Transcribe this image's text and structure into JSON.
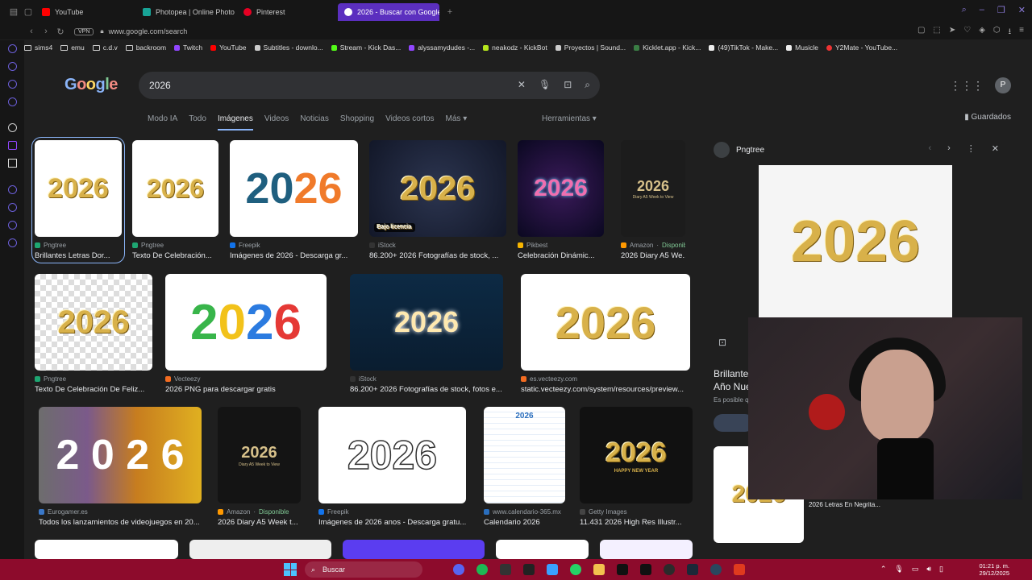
{
  "tabs": [
    {
      "label": "YouTube",
      "color": "#ff0000"
    },
    {
      "label": "Photopea | Online Photo E",
      "color": "#18a497"
    },
    {
      "label": "Pinterest",
      "color": "#e60023"
    },
    {
      "label": "2026 - Buscar con Google",
      "color": "#4285f4",
      "active": true
    }
  ],
  "address": {
    "vpn": "VPN",
    "url": "www.google.com/search"
  },
  "bookmarks": [
    "sims4",
    "emu",
    "c.d.v",
    "backroom",
    "Twitch",
    "YouTube",
    "Subtitles - downlo...",
    "Stream - Kick Das...",
    "alyssamydudes -...",
    "neakodz - KickBot",
    "Proyectos | Sound...",
    "Kicklet.app - Kick...",
    "(49)TikTok - Make...",
    "Musicle",
    "Y2Mate - YouTube..."
  ],
  "google": {
    "logo": "Google",
    "query": "2026",
    "avatar": "P",
    "nav": [
      "Modo IA",
      "Todo",
      "Imágenes",
      "Videos",
      "Noticias",
      "Shopping",
      "Videos cortos",
      "Más"
    ],
    "active_nav": "Imágenes",
    "tools": "Herramientas",
    "saved": "Guardados"
  },
  "results": [
    {
      "source": "Pngtree",
      "caption": "Brillantes Letras Dor...",
      "color": "#1ea672"
    },
    {
      "source": "Pngtree",
      "caption": "Texto De Celebración...",
      "color": "#1ea672"
    },
    {
      "source": "Freepik",
      "caption": "Imágenes de 2026 - Descarga gr...",
      "color": "#1273eb"
    },
    {
      "source": "iStock",
      "caption": "86.200+ 2026 Fotografías de stock, ...",
      "color": "#333333",
      "badge": "Bajo licencia"
    },
    {
      "source": "Pikbest",
      "caption": "Celebración Dinámic...",
      "color": "#f7b500"
    },
    {
      "source": "Amazon",
      "avail": "Disponible",
      "caption": "2026 Diary A5 We...",
      "color": "#ff9900"
    },
    {
      "source": "Pngtree",
      "caption": "Texto De Celebración De Feliz...",
      "color": "#1ea672"
    },
    {
      "source": "Vecteezy",
      "caption": "2026 PNG para descargar gratis",
      "color": "#f36c21"
    },
    {
      "source": "iStock",
      "caption": "86.200+ 2026 Fotografías de stock, fotos e...",
      "color": "#333333"
    },
    {
      "source": "es.vecteezy.com",
      "caption": "static.vecteezy.com/system/resources/preview...",
      "color": "#f36c21"
    },
    {
      "source": "Eurogamer.es",
      "caption": "Todos los lanzamientos de videojuegos en 20...",
      "color": "#3a78c9"
    },
    {
      "source": "Amazon",
      "avail": "Disponible",
      "caption": "2026 Diary A5 Week t...",
      "color": "#ff9900"
    },
    {
      "source": "Freepik",
      "caption": "Imágenes de 2026 anos - Descarga gratu...",
      "color": "#1273eb"
    },
    {
      "source": "www.calendario-365.mx",
      "caption": "Calendario 2026",
      "color": "#2a6ebd"
    },
    {
      "source": "Getty Images",
      "caption": "11.431 2026 High Res Illustr...",
      "color": "#444444"
    }
  ],
  "thumb_text": {
    "year": "2026",
    "hny": "HAPPY NEW YEAR",
    "diary": "Diary A5 Week to View",
    "year_spaced": "2 0 2 6"
  },
  "preview": {
    "source": "Pngtree",
    "title": "Brillante\nAño Nue",
    "sub": "Es posible q",
    "image_text": "2026"
  },
  "webcam_caption": "2026 Letras En Negrita...",
  "taskbar": {
    "search": "Buscar",
    "time": "01:21 p. m.",
    "date": "29/12/2025"
  }
}
